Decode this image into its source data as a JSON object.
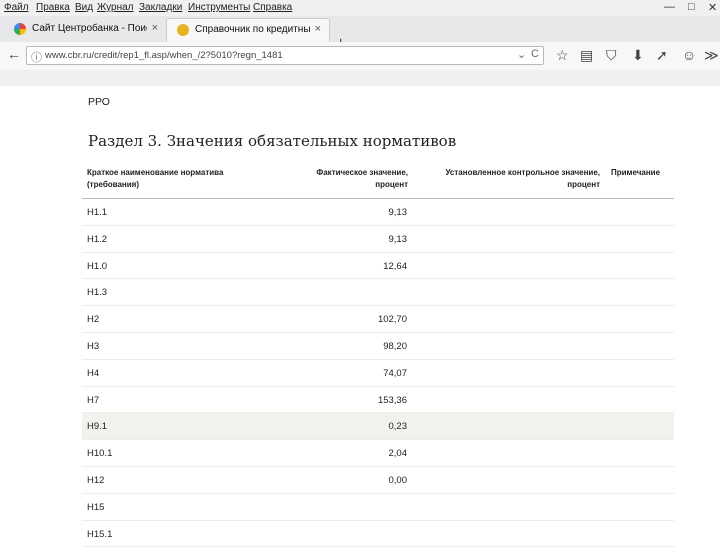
{
  "browser": {
    "menu": [
      "Файл",
      "Правка",
      "Вид",
      "Журнал",
      "Закладки",
      "Инструменты",
      "Справка"
    ],
    "tabs": [
      {
        "title": "Сайт Центробанка - Поис...",
        "close": "×",
        "active": false
      },
      {
        "title": "Справочник по кредитны...",
        "close": "×",
        "active": true
      }
    ],
    "new_tab": "+",
    "url": "www.cbr.ru/credit/rep1_fl.asp/when_/2?5010?regn_1481",
    "window_controls": {
      "minimize": "—",
      "maximize": "□",
      "close": "✕"
    },
    "icons": {
      "back": "←",
      "info": "ⓘ",
      "reload": "C",
      "dropdown": "⌄",
      "star": "☆",
      "reader": "▤",
      "pocket": "⛉",
      "download": "⬇",
      "send": "➚",
      "smile": "☺",
      "menu": "≫"
    }
  },
  "page": {
    "preamble": "РРО",
    "heading": "Раздел 3. Значения обязательных нормативов",
    "table": {
      "headers": {
        "name": "Краткое наименование норматива (требования)",
        "actual": "Фактическое значение, процент",
        "control": "Установленное контрольное значение, процент",
        "note": "Примечание"
      },
      "rows": [
        {
          "name": "Н1.1",
          "actual": "9,13",
          "control": "",
          "note": ""
        },
        {
          "name": "Н1.2",
          "actual": "9,13",
          "control": "",
          "note": ""
        },
        {
          "name": "Н1.0",
          "actual": "12,64",
          "control": "",
          "note": ""
        },
        {
          "name": "Н1.3",
          "actual": "",
          "control": "",
          "note": ""
        },
        {
          "name": "Н2",
          "actual": "102,70",
          "control": "",
          "note": ""
        },
        {
          "name": "Н3",
          "actual": "98,20",
          "control": "",
          "note": ""
        },
        {
          "name": "Н4",
          "actual": "74,07",
          "control": "",
          "note": ""
        },
        {
          "name": "Н7",
          "actual": "153,36",
          "control": "",
          "note": ""
        },
        {
          "name": "Н9.1",
          "actual": "0,23",
          "control": "",
          "note": ""
        },
        {
          "name": "Н10.1",
          "actual": "2,04",
          "control": "",
          "note": ""
        },
        {
          "name": "Н12",
          "actual": "0,00",
          "control": "",
          "note": ""
        },
        {
          "name": "Н15",
          "actual": "",
          "control": "",
          "note": ""
        },
        {
          "name": "Н15.1",
          "actual": "",
          "control": "",
          "note": ""
        }
      ],
      "highlighted_row_color": "#f3f1ec"
    }
  }
}
